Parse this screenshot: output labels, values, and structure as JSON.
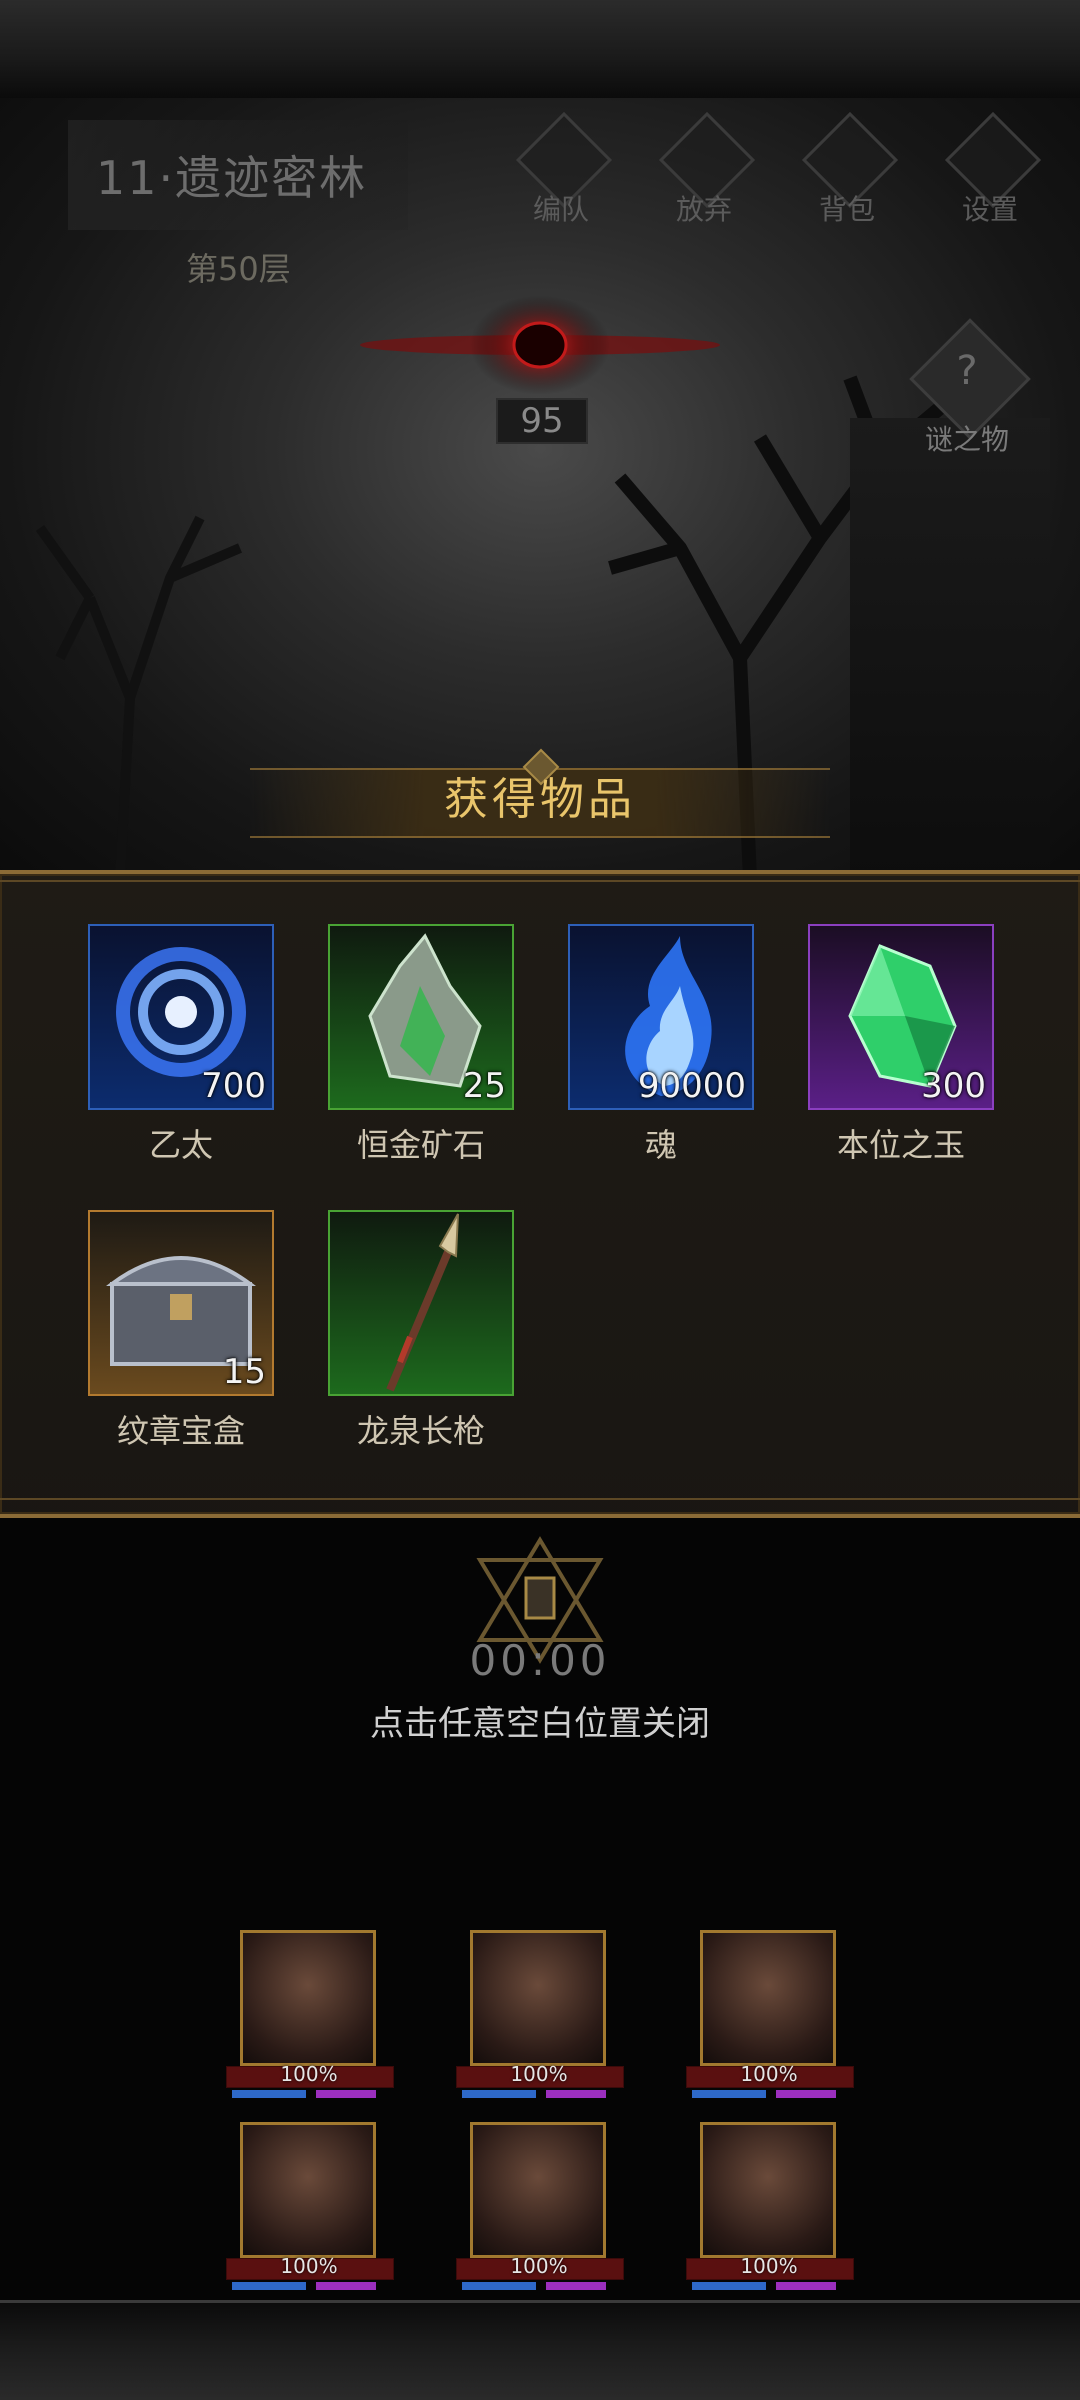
{
  "stage": {
    "title": "11·遗迹密林",
    "floor": "第50层"
  },
  "top_menu": [
    {
      "label": "编队",
      "icon": "team-icon"
    },
    {
      "label": "放弃",
      "icon": "abandon-icon"
    },
    {
      "label": "背包",
      "icon": "bag-icon"
    },
    {
      "label": "设置",
      "icon": "settings-icon"
    }
  ],
  "eye_counter": "95",
  "mystery": {
    "label": "谜之物",
    "icon": "question-mark-icon"
  },
  "reward": {
    "title": "获得物品",
    "items": [
      {
        "name": "乙太",
        "qty": "700",
        "rarity": "blue",
        "icon": "aether-vortex-icon"
      },
      {
        "name": "恒金矿石",
        "qty": "25",
        "rarity": "green",
        "icon": "ore-crystal-icon"
      },
      {
        "name": "魂",
        "qty": "90000",
        "rarity": "blue",
        "icon": "soul-flame-icon"
      },
      {
        "name": "本位之玉",
        "qty": "300",
        "rarity": "purple",
        "icon": "green-gem-icon"
      },
      {
        "name": "纹章宝盒",
        "qty": "15",
        "rarity": "orange",
        "icon": "treasure-chest-icon"
      },
      {
        "name": "龙泉长枪",
        "qty": "",
        "rarity": "green",
        "icon": "spear-icon"
      }
    ]
  },
  "timer": "00:00",
  "close_hint": "点击任意空白位置关闭",
  "heroes": [
    {
      "hp": "100%"
    },
    {
      "hp": "100%"
    },
    {
      "hp": "100%"
    },
    {
      "hp": "100%"
    },
    {
      "hp": "100%"
    },
    {
      "hp": "100%"
    }
  ],
  "colors": {
    "gold_title": "#e9c56b",
    "panel_border": "#8b6b36",
    "rarity_blue": "#2d5fb8",
    "rarity_green": "#49a334",
    "rarity_purple": "#8b3fc0",
    "rarity_orange": "#b37a2f"
  }
}
